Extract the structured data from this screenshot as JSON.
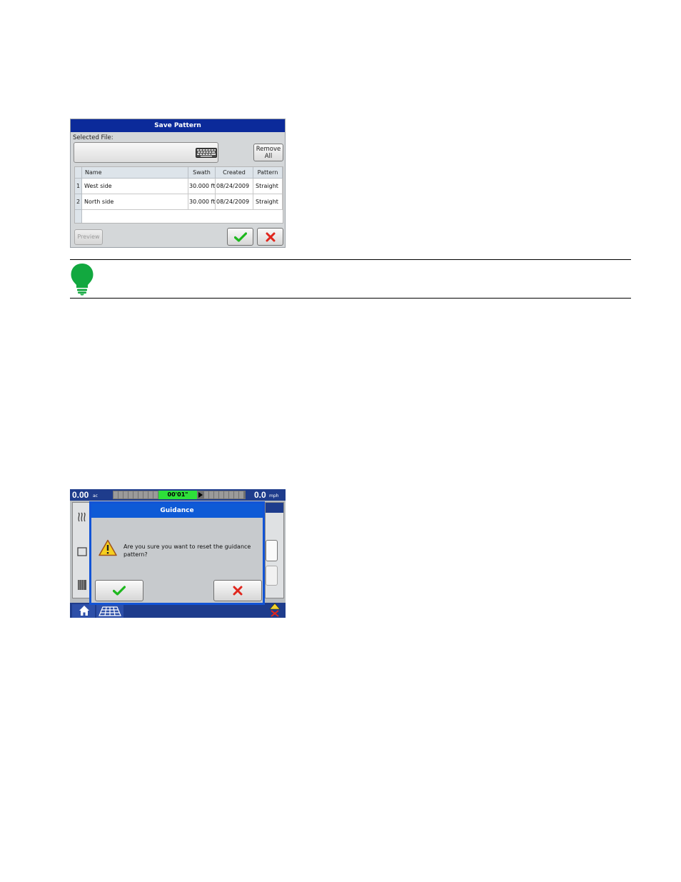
{
  "save_pattern": {
    "title": "Save Pattern",
    "selected_file_label": "Selected File:",
    "selected_file_value": "",
    "remove_all_line1": "Remove",
    "remove_all_line2": "All",
    "columns": [
      "Name",
      "Swath",
      "Created",
      "Pattern"
    ],
    "rows": [
      {
        "num": "1",
        "name": "West side",
        "swath": "30.000 ft",
        "created": "08/24/2009",
        "pattern": "Straight"
      },
      {
        "num": "2",
        "name": "North side",
        "swath": "30.000 ft",
        "created": "08/24/2009",
        "pattern": "Straight"
      }
    ],
    "preview_label": "Preview",
    "icons": {
      "keyboard": "keyboard-icon",
      "ok": "checkmark-icon",
      "cancel": "x-icon"
    },
    "colors": {
      "title_bar": "#0b2a9a",
      "ok": "#1fb81f",
      "cancel": "#e0261d"
    }
  },
  "note": {
    "icon": "lightbulb-icon",
    "icon_color": "#12a83f"
  },
  "guidance_screen": {
    "area_value": "0.00",
    "area_unit": "ac",
    "speed_value": "0.0",
    "speed_unit": "mph",
    "lightbar_text": "00'01\"",
    "dialog": {
      "title": "Guidance",
      "message": "Are you sure you want to reset the guidance pattern?",
      "icons": {
        "warning": "warning-icon",
        "ok": "checkmark-icon",
        "cancel": "x-icon"
      }
    },
    "bottom_icons": [
      "home-icon",
      "field-grid-icon",
      "gps-status-icon"
    ],
    "colors": {
      "bars": "#1e3c8c",
      "dialog_title": "#0e5ad6",
      "lightbar_center": "#2ee03a"
    }
  }
}
